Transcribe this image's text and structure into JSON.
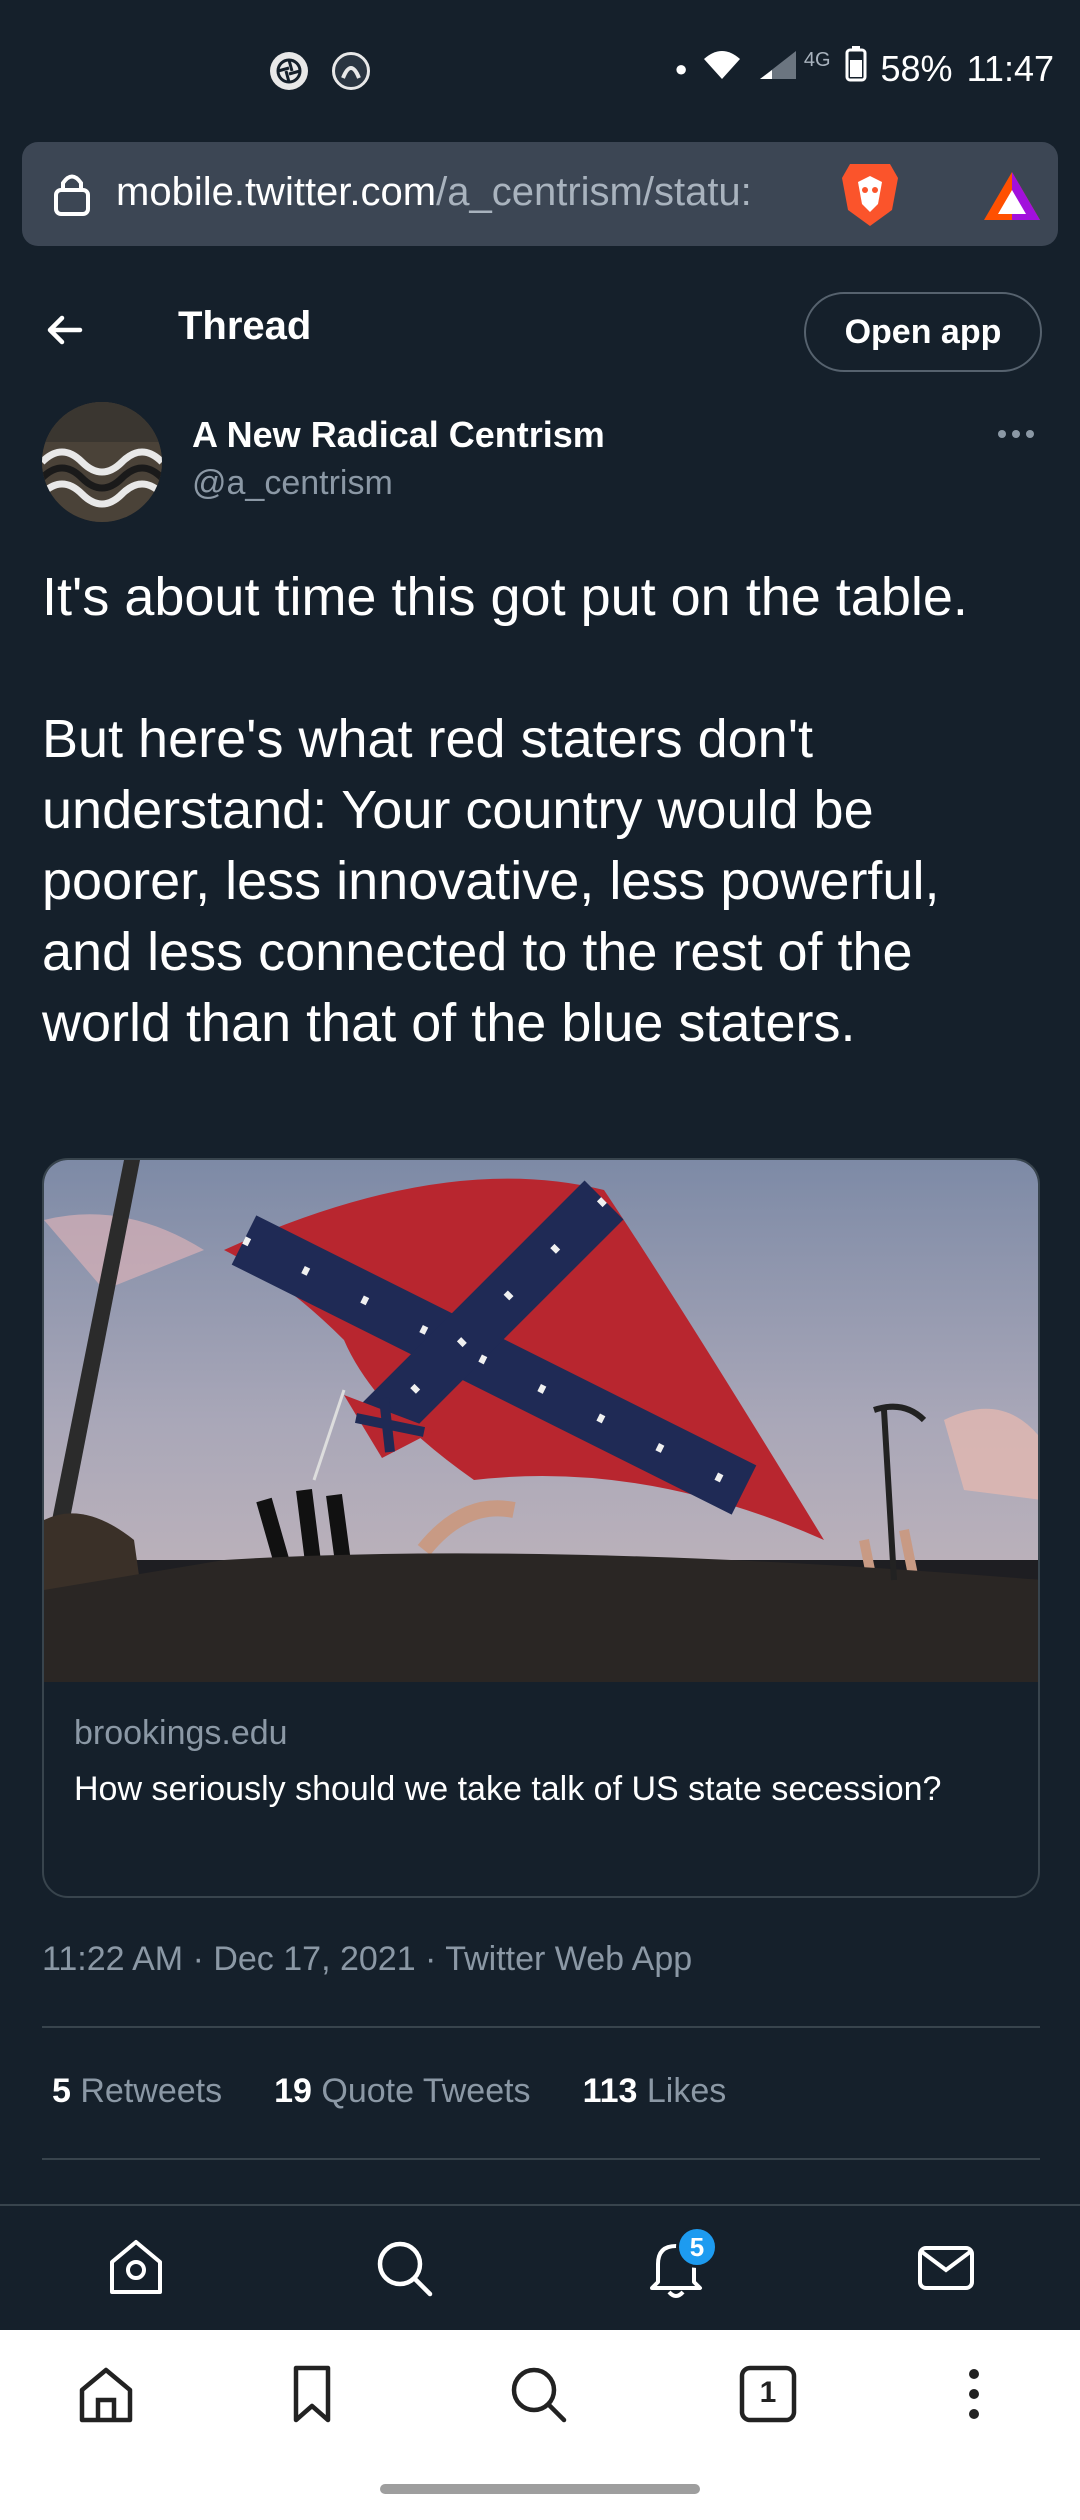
{
  "status_bar": {
    "battery": "58%",
    "time": "11:47",
    "network": "4G"
  },
  "browser": {
    "url_host": "mobile.twitter.com",
    "url_path": "/a_centrism/statu:"
  },
  "header": {
    "title": "Thread",
    "open_app": "Open app"
  },
  "tweet": {
    "author_name": "A New Radical Centrism",
    "author_handle": "@a_centrism",
    "text": "It's about time this got put on the table.\n\nBut here's what red staters don't understand: Your country would be poorer, less innovative, less powerful, and less connected to the rest of the world than that of the blue staters.",
    "card": {
      "domain": "brookings.edu",
      "title": "How seriously should we take talk of US state secession?"
    },
    "timestamp": "11:22 AM · Dec 17, 2021 · Twitter Web App",
    "stats": {
      "retweets_count": "5",
      "retweets_label": "Retweets",
      "quotes_count": "19",
      "quotes_label": "Quote Tweets",
      "likes_count": "113",
      "likes_label": "Likes"
    }
  },
  "twitter_nav": {
    "notifications_badge": "5"
  },
  "browser_nav": {
    "tab_count": "1"
  },
  "colors": {
    "background": "#15202b",
    "accent": "#1d9bf0",
    "secondary_text": "#8b98a5"
  }
}
